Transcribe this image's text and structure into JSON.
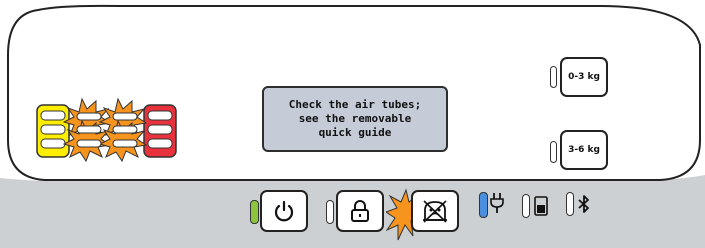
{
  "display": {
    "message": "Check the air tubes;\nsee the removable\nquick guide"
  },
  "load_buttons": [
    {
      "label": "0-3 kg"
    },
    {
      "label": "3-6 kg"
    }
  ],
  "level_indicator": {
    "columns": [
      {
        "color": "#ffee00",
        "state": "on"
      },
      {
        "color": "#f7941d",
        "state": "blinking"
      },
      {
        "color": "#f7941d",
        "state": "blinking"
      },
      {
        "color": "#e8323c",
        "state": "on"
      }
    ]
  },
  "bottom_controls": {
    "power_icon": "power-icon",
    "power_led_color": "#8cc63f",
    "lock_icon": "lock-icon",
    "alarm_icon": "pump-alarm-icon",
    "alarm_flash_color": "#f7941d",
    "plug_icon": "plug-icon",
    "plug_led_color": "#4a8fe0",
    "battery_icon": "battery-icon",
    "bluetooth_icon": "bluetooth-icon"
  },
  "colors": {
    "panel_top": "#ffffff",
    "panel_bottom": "#cdd0d2",
    "outline": "#222222"
  }
}
